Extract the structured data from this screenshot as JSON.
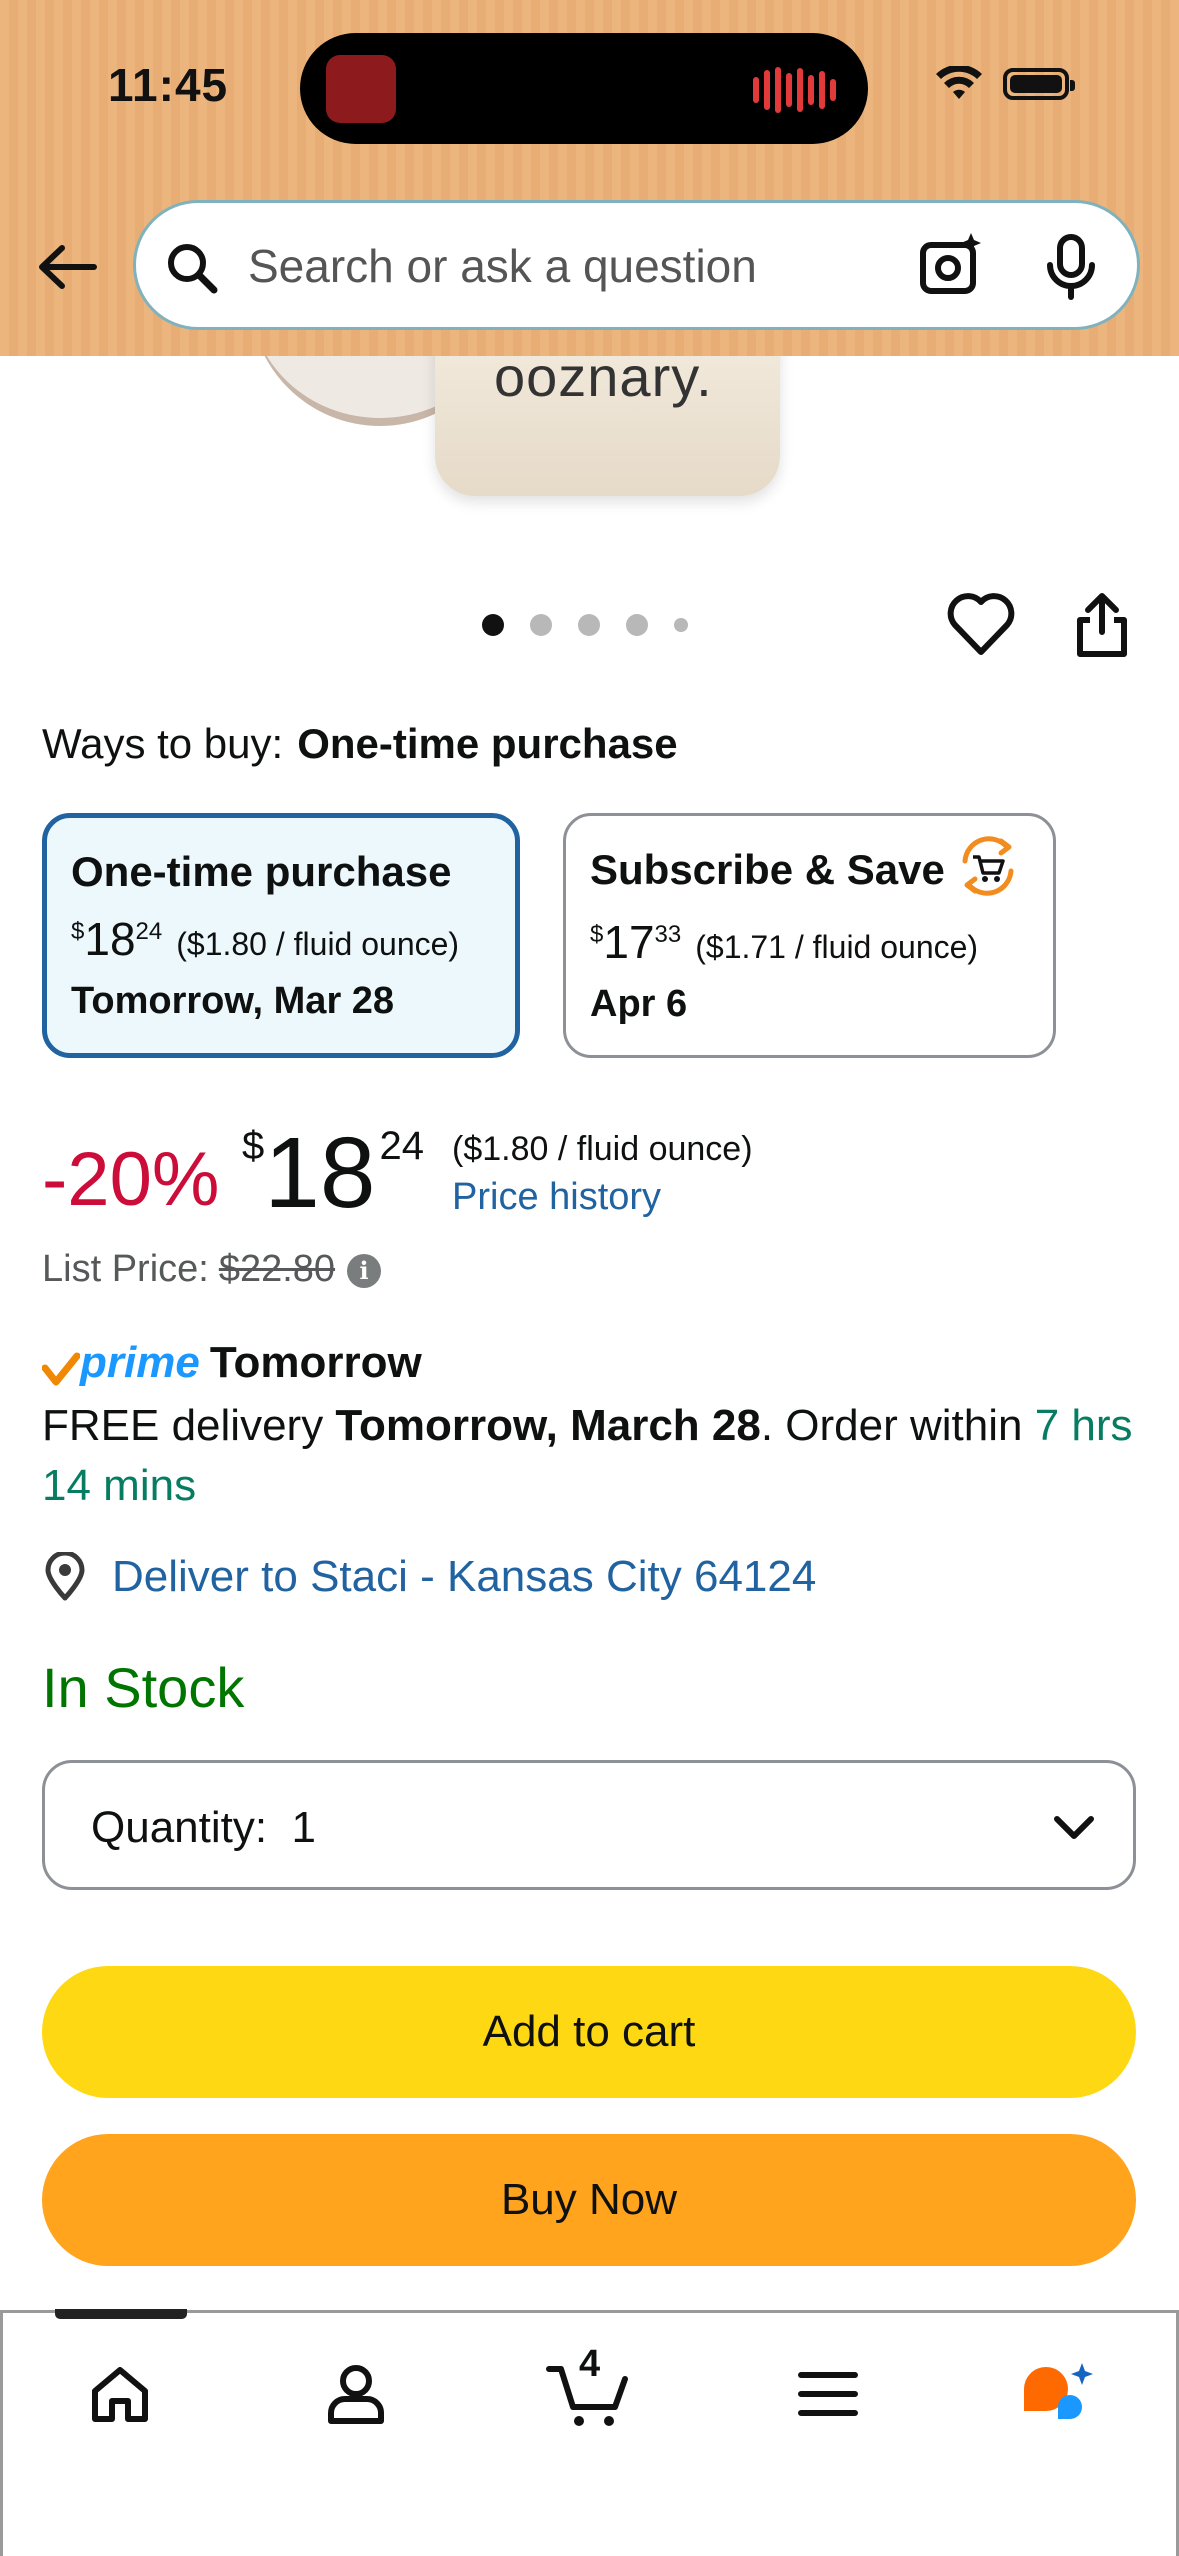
{
  "status_bar": {
    "time": "11:45"
  },
  "header": {
    "search_placeholder": "Search or ask a question",
    "background_color": "#ecb57e"
  },
  "product_image": {
    "brand_text": "ooznary."
  },
  "carousel": {
    "image_count": 5,
    "active_index": 0
  },
  "ways_to_buy": {
    "label": "Ways to buy:",
    "selected": "One-time purchase",
    "options": [
      {
        "title": "One-time purchase",
        "price_currency": "$",
        "price_whole": "18",
        "price_fraction": "24",
        "unit_price": "($1.80 / fluid ounce)",
        "delivery": "Tomorrow, Mar 28",
        "selected": true
      },
      {
        "title": "Subscribe & Save",
        "price_currency": "$",
        "price_whole": "17",
        "price_fraction": "33",
        "unit_price": "($1.71 / fluid ounce)",
        "delivery": "Apr 6",
        "selected": false
      }
    ]
  },
  "price": {
    "discount": "-20%",
    "currency": "$",
    "whole": "18",
    "fraction": "24",
    "unit_price": "($1.80 / fluid ounce)",
    "history_link": "Price history",
    "list_price_label": "List Price:",
    "list_price": "$22.80"
  },
  "delivery": {
    "prime_label": "prime",
    "prime_speed": "Tomorrow",
    "free_delivery": "FREE delivery",
    "date": "Tomorrow, March 28",
    "order_within": ". Order within",
    "countdown": "7 hrs 14 mins",
    "deliver_to": "Deliver to Staci - Kansas City 64124"
  },
  "stock": {
    "status": "In Stock"
  },
  "quantity": {
    "label": "Quantity:",
    "value": "1"
  },
  "actions": {
    "add_to_cart": "Add to cart",
    "buy_now": "Buy Now"
  },
  "bottom_nav": {
    "items": [
      "home-icon",
      "profile-icon",
      "cart-icon",
      "menu-icon",
      "rufus-icon"
    ],
    "cart_count": "4"
  },
  "colors": {
    "accent_link": "#2162a1",
    "discount_red": "#cc0c39",
    "in_stock_green": "#007600",
    "add_to_cart_yellow": "#ffd814",
    "buy_now_orange": "#ffa41c",
    "selected_option_border": "#2162a1",
    "prime_blue": "#1a98ff"
  }
}
